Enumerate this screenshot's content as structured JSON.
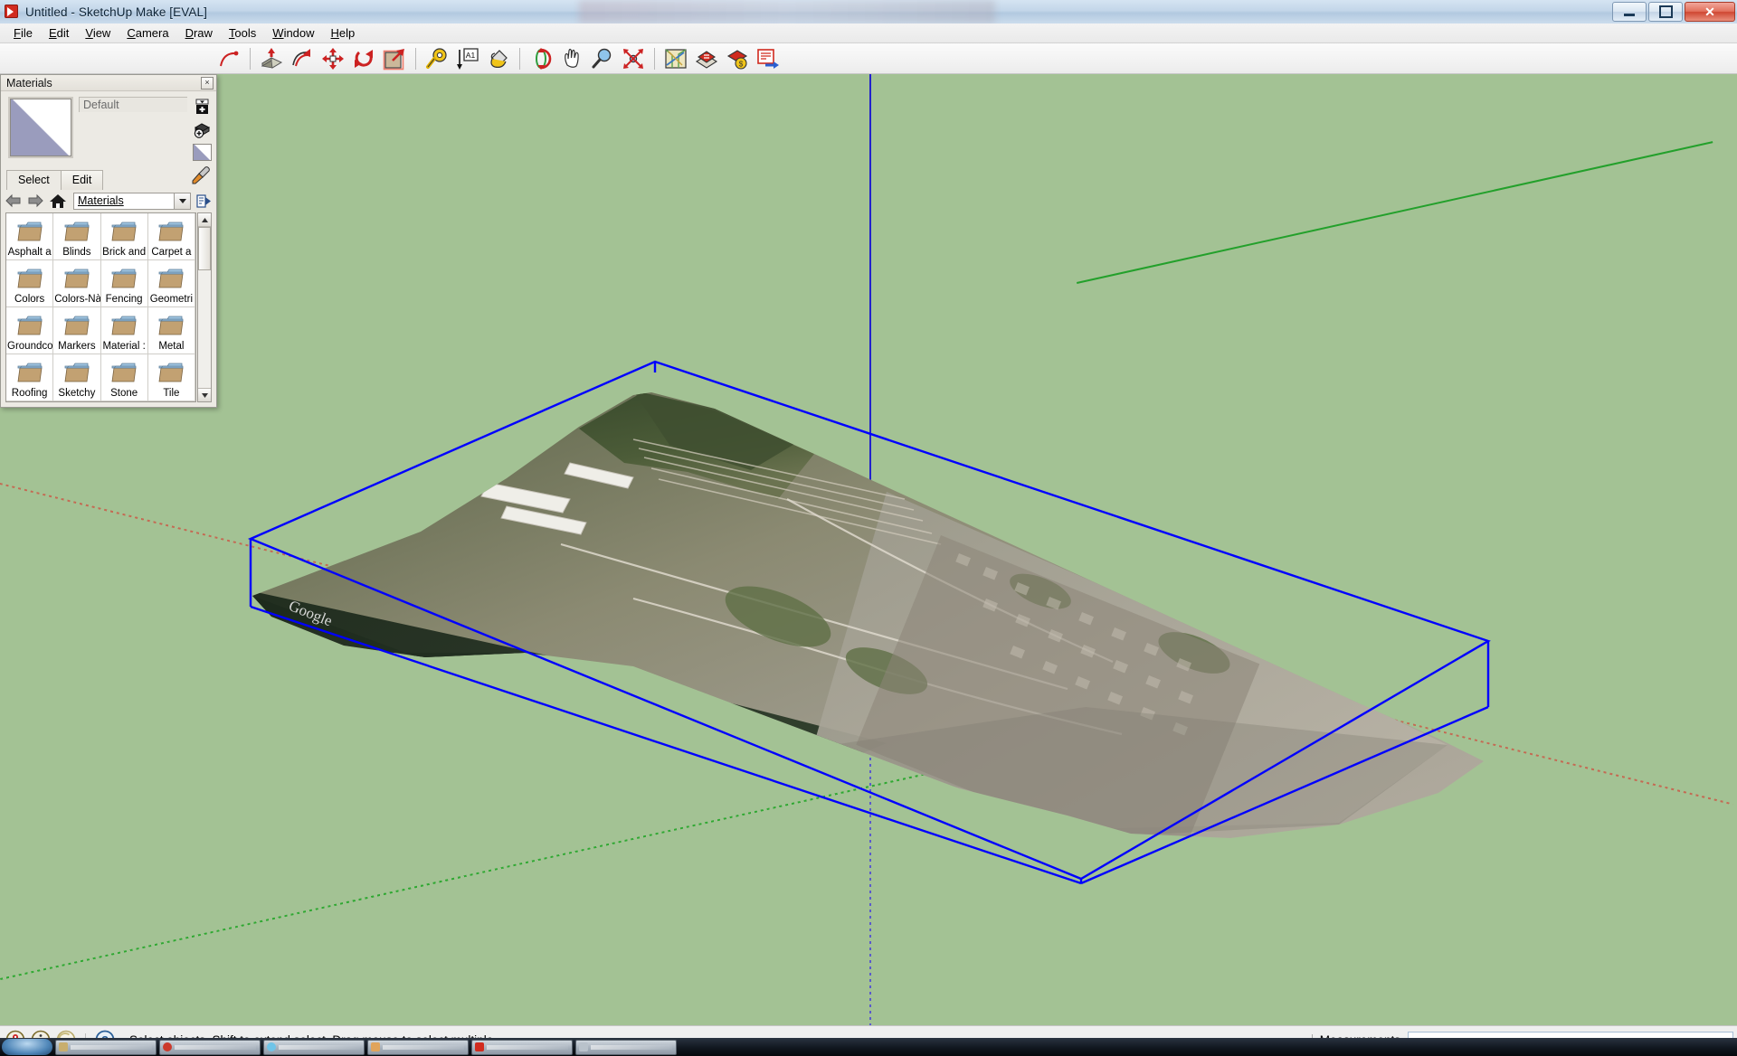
{
  "window": {
    "title": "Untitled - SketchUp Make [EVAL]",
    "app_icon": "sketchup-icon",
    "controls": {
      "minimize": "minimize-button",
      "maximize": "maximize-button",
      "close": "close-button"
    }
  },
  "menubar": {
    "items": [
      {
        "label": "File",
        "accel": "F"
      },
      {
        "label": "Edit",
        "accel": "E"
      },
      {
        "label": "View",
        "accel": "V"
      },
      {
        "label": "Camera",
        "accel": "C"
      },
      {
        "label": "Draw",
        "accel": "D"
      },
      {
        "label": "Tools",
        "accel": "T"
      },
      {
        "label": "Window",
        "accel": "W"
      },
      {
        "label": "Help",
        "accel": "H"
      }
    ]
  },
  "toolbar": {
    "groups": [
      {
        "name": "drawing-partial",
        "buttons": [
          {
            "name": "arc-tool",
            "title": "Arc"
          }
        ]
      },
      {
        "name": "modification",
        "buttons": [
          {
            "name": "pushpull-tool",
            "title": "Push/Pull"
          },
          {
            "name": "followme-tool",
            "title": "Follow Me"
          },
          {
            "name": "move-tool",
            "title": "Move"
          },
          {
            "name": "rotate-tool",
            "title": "Rotate"
          },
          {
            "name": "scale-tool",
            "title": "Scale"
          }
        ]
      },
      {
        "name": "construction",
        "buttons": [
          {
            "name": "tape-measure-tool",
            "title": "Tape Measure"
          },
          {
            "name": "dimension-tool",
            "title": "Dimension"
          },
          {
            "name": "paint-bucket-tool",
            "title": "Paint Bucket"
          }
        ]
      },
      {
        "name": "camera",
        "buttons": [
          {
            "name": "orbit-tool",
            "title": "Orbit"
          },
          {
            "name": "pan-tool",
            "title": "Pan"
          },
          {
            "name": "zoom-tool",
            "title": "Zoom"
          },
          {
            "name": "zoom-extents-tool",
            "title": "Zoom Extents"
          }
        ]
      },
      {
        "name": "location",
        "buttons": [
          {
            "name": "add-location-icon",
            "title": "Add Location"
          },
          {
            "name": "toggle-terrain-icon",
            "title": "Toggle Terrain"
          },
          {
            "name": "photo-textures-icon",
            "title": "Add Photo Texture"
          },
          {
            "name": "share-model-icon",
            "title": "Share Model"
          }
        ]
      }
    ]
  },
  "materials_panel": {
    "title": "Materials",
    "close_label": "×",
    "current_material_name": "Default",
    "swatch_name": "default-material-swatch",
    "side_buttons": [
      {
        "name": "create-material-button",
        "title": "Create Material"
      },
      {
        "name": "set-as-default-button",
        "title": "Set Material To Paint With To Default"
      },
      {
        "name": "material-preview",
        "title": "Material Preview"
      },
      {
        "name": "sample-material-button",
        "title": "Sample Paint"
      },
      {
        "name": "details-flyout-button",
        "title": "Details"
      }
    ],
    "tabs": [
      {
        "label": "Select",
        "active": true
      },
      {
        "label": "Edit",
        "active": false
      }
    ],
    "nav": {
      "back": "back-arrow-icon",
      "forward": "forward-arrow-icon",
      "home": "home-icon",
      "collection": "Materials",
      "details": "details-button"
    },
    "library_items": [
      {
        "label": "Asphalt a",
        "icon": "folder-icon"
      },
      {
        "label": "Blinds",
        "icon": "folder-icon"
      },
      {
        "label": "Brick and",
        "icon": "folder-icon"
      },
      {
        "label": "Carpet a",
        "icon": "folder-icon"
      },
      {
        "label": "Colors",
        "icon": "folder-icon"
      },
      {
        "label": "Colors-Nà",
        "icon": "folder-icon"
      },
      {
        "label": "Fencing",
        "icon": "folder-icon"
      },
      {
        "label": "Geometri",
        "icon": "folder-icon"
      },
      {
        "label": "Groundco",
        "icon": "folder-icon"
      },
      {
        "label": "Markers",
        "icon": "folder-icon"
      },
      {
        "label": "Material :",
        "icon": "folder-icon"
      },
      {
        "label": "Metal",
        "icon": "folder-icon"
      },
      {
        "label": "Roofing",
        "icon": "folder-icon"
      },
      {
        "label": "Sketchy",
        "icon": "folder-icon"
      },
      {
        "label": "Stone",
        "icon": "folder-icon"
      },
      {
        "label": "Tile",
        "icon": "folder-icon"
      }
    ]
  },
  "viewport": {
    "background_color": "#a3c294",
    "selection_color": "#0000ff",
    "axes": {
      "red": "#c23a28",
      "green": "#23a02b",
      "blue": "#2222cc"
    },
    "model": {
      "name": "geo-located-terrain-model",
      "watermark": "Google",
      "selected": true
    }
  },
  "statusbar": {
    "icons": [
      {
        "name": "geo-location-icon"
      },
      {
        "name": "credits-info-icon"
      },
      {
        "name": "claim-credit-icon"
      },
      {
        "name": "instructor-help-icon"
      }
    ],
    "message": "Select objects. Shift to extend select. Drag mouse to select multiple.",
    "measurements_label": "Measurements",
    "measurements_value": "",
    "measurements_placeholder": ""
  },
  "taskbar": {
    "start_button": "start-button",
    "tasks": [
      {
        "name": "taskbar-item-1",
        "color": "#c8ae6e"
      },
      {
        "name": "taskbar-item-2",
        "color": "#cc3a2c"
      },
      {
        "name": "taskbar-item-3",
        "color": "#6fc4e8"
      },
      {
        "name": "taskbar-item-4",
        "color": "#e0a45c"
      },
      {
        "name": "taskbar-item-5",
        "color": "#d22b1e"
      },
      {
        "name": "taskbar-item-6",
        "color": "#b9c2cb"
      }
    ]
  }
}
